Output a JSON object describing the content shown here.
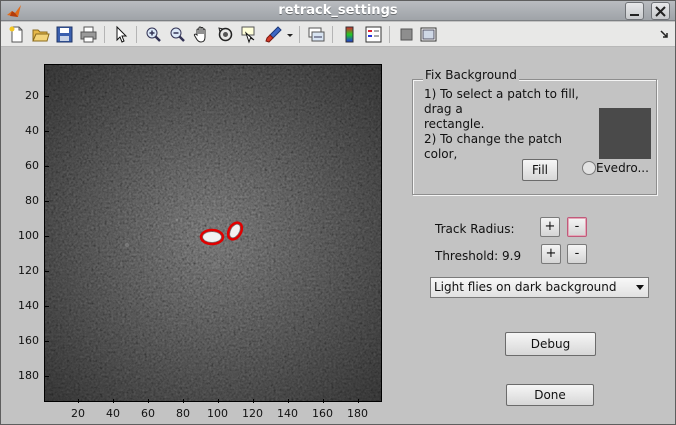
{
  "window": {
    "title": "retrack_settings"
  },
  "toolbar": {
    "icons": [
      "new-file-icon",
      "open-folder-icon",
      "save-icon",
      "print-icon",
      "pointer-icon",
      "zoom-in-icon",
      "zoom-out-icon",
      "pan-hand-icon",
      "rotate-3d-icon",
      "data-cursor-icon",
      "brush-icon",
      "dropdown-arrow-icon",
      "link-plot-icon",
      "colorbar-icon",
      "legend-icon",
      "hide-plot-tools-icon",
      "show-plot-tools-icon",
      "dock-icon"
    ]
  },
  "axes": {
    "yticks": [
      "20",
      "40",
      "60",
      "80",
      "100",
      "120",
      "140",
      "160",
      "180"
    ],
    "xticks": [
      "20",
      "40",
      "60",
      "80",
      "100",
      "120",
      "140",
      "160",
      "180"
    ]
  },
  "fix_background": {
    "title": "Fix Background",
    "line1": "1) To select a patch to fill,",
    "line2": "drag a",
    "line3": "rectangle.",
    "line4": "2) To change the patch color,",
    "fill_label": "Fill",
    "radio_label": "Evedro...",
    "swatch_color": "#4a4a4a"
  },
  "track_radius": {
    "label": "Track Radius:",
    "plus": "+",
    "minus": "-"
  },
  "threshold": {
    "label": "Threshold:",
    "value": "9.9",
    "plus": "+",
    "minus": "-"
  },
  "mode_select": {
    "value": "Light flies on dark background"
  },
  "debug_label": "Debug",
  "done_label": "Done"
}
